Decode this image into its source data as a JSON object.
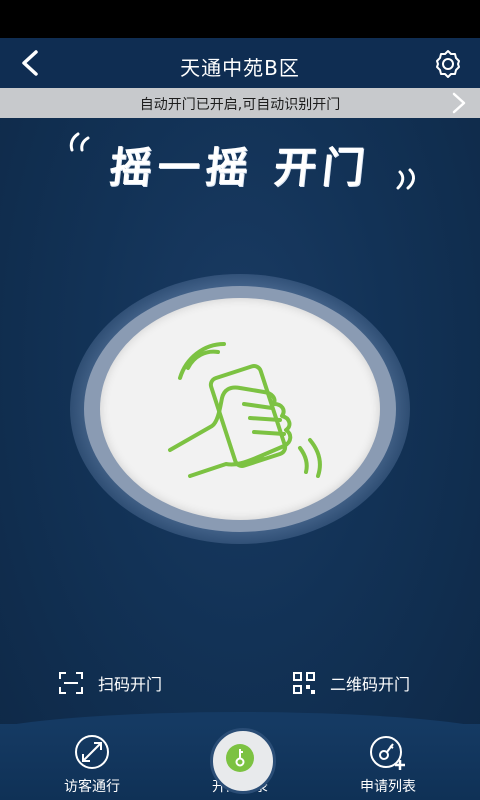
{
  "nav": {
    "title": "天通中苑B区",
    "back_icon": "chevron-left-icon",
    "settings_icon": "gear-icon"
  },
  "notice": {
    "text": "自动开门已开启,可自动识别开门",
    "arrow_icon": "chevron-right-icon"
  },
  "hero": {
    "title": "摇一摇 开门"
  },
  "shake_button": {
    "icon": "phone-shake-hand-icon",
    "accent": "#7cc242"
  },
  "quick_actions": {
    "scan_label": "扫码开门",
    "qr_label": "二维码开门"
  },
  "tabs": [
    {
      "label": "访客通行",
      "icon": "visitor-pass-icon"
    },
    {
      "label": "开门记录",
      "icon": "key-icon"
    },
    {
      "label": "申请列表",
      "icon": "key-add-icon"
    }
  ],
  "colors": {
    "background": "#123256",
    "notice_bg": "#c7c9cc",
    "accent_green": "#7cc242"
  }
}
